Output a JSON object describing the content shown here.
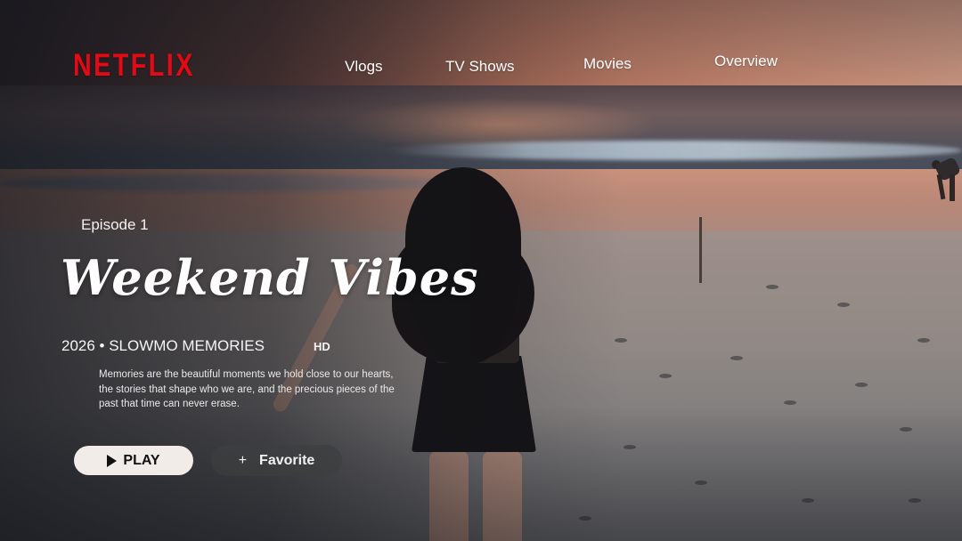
{
  "brand": {
    "logo_text": "NETFLIX",
    "color": "#e50914"
  },
  "nav": {
    "items": [
      {
        "label": "Vlogs"
      },
      {
        "label": "TV Shows"
      },
      {
        "label": "Movies"
      },
      {
        "label": "Overview"
      }
    ]
  },
  "hero": {
    "episode": "Episode 1",
    "title": "Weekend Vibes",
    "meta": "2026 • SLOWMO MEMORIES",
    "quality_badge": "HD",
    "description": "Memories are the beautiful moments we hold close to our hearts, the stories that shape who we are, and the precious pieces of the past that time can never erase."
  },
  "actions": {
    "play": {
      "label": "PLAY",
      "icon": "play-icon",
      "bg": "#f1ece8"
    },
    "favorite": {
      "label": "Favorite",
      "icon": "plus-icon"
    }
  }
}
